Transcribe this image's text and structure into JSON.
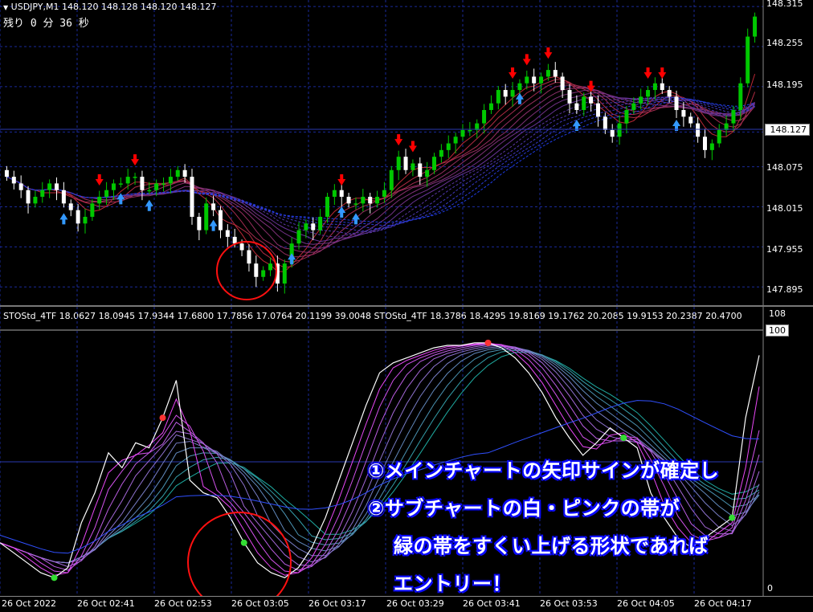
{
  "main_header": {
    "symbol_line": "USDJPY,M1  148.120 148.128 148.120 148.127",
    "countdown": "残り 0 分 36 秒"
  },
  "price_axis": {
    "ticks": [
      "148.315",
      "148.255",
      "148.195",
      "148.127",
      "148.075",
      "148.015",
      "147.955",
      "147.895"
    ],
    "current_price": "148.127"
  },
  "sub_header": {
    "text": "STOStd_4TF 18.0627 18.0945 17.9344 17.6800 17.7856 17.0764 20.1199 39.0048  STOStd_4TF 18.3786 18.4295 19.8169 19.1762 20.2085 19.9153 20.2387 20.4700"
  },
  "sub_axis": {
    "top_label": "108",
    "level_label": "100",
    "bottom_label": "0"
  },
  "time_axis": {
    "labels": [
      "26 Oct 2022",
      "26 Oct 02:41",
      "26 Oct 02:53",
      "26 Oct 03:05",
      "26 Oct 03:17",
      "26 Oct 03:29",
      "26 Oct 03:41",
      "26 Oct 03:53",
      "26 Oct 04:05",
      "26 Oct 04:17"
    ]
  },
  "annotations": {
    "line1": "①メインチャートの矢印サインが確定し",
    "line2": "②サブチャートの白・ピンクの帯が",
    "line3": "緑の帯をすくい上げる形状であれば",
    "line4": "エントリー！"
  },
  "colors": {
    "bull_candle": "#00c800",
    "bear_candle": "#ffffff",
    "up_arrow": "#3399ff",
    "down_arrow": "#ff0000",
    "grid": "#1a2a9a",
    "highlight_circle": "#ff0000",
    "stoch_white": "#ffffff",
    "stoch_pink": "#ff44ff",
    "stoch_green": "#20b0a0"
  },
  "chart_data": [
    {
      "type": "candlestick",
      "title": "USDJPY,M1",
      "ylim": [
        147.87,
        148.32
      ],
      "y_ticks": [
        147.895,
        147.955,
        148.015,
        148.075,
        148.127,
        148.195,
        148.255,
        148.315
      ],
      "close_approx": [
        148.06,
        148.05,
        148.04,
        148.02,
        148.03,
        148.04,
        148.05,
        148.04,
        148.02,
        148.01,
        147.99,
        148.0,
        148.02,
        148.03,
        148.04,
        148.05,
        148.05,
        148.06,
        148.06,
        148.04,
        148.04,
        148.05,
        148.05,
        148.06,
        148.07,
        148.06,
        148.0,
        147.98,
        148.02,
        148.01,
        147.98,
        147.97,
        147.96,
        147.95,
        147.93,
        147.91,
        147.92,
        147.93,
        147.9,
        147.93,
        147.96,
        147.98,
        147.99,
        147.98,
        148.0,
        148.03,
        148.04,
        148.03,
        148.02,
        148.02,
        148.03,
        148.02,
        148.03,
        148.04,
        148.07,
        148.09,
        148.07,
        148.08,
        148.06,
        148.07,
        148.09,
        148.1,
        148.11,
        148.12,
        148.13,
        148.13,
        148.14,
        148.16,
        148.17,
        148.19,
        148.18,
        148.19,
        148.2,
        148.21,
        148.2,
        148.21,
        148.22,
        148.21,
        148.19,
        148.17,
        148.16,
        148.18,
        148.17,
        148.15,
        148.13,
        148.12,
        148.14,
        148.16,
        148.17,
        148.18,
        148.19,
        148.2,
        148.19,
        148.18,
        148.16,
        148.15,
        148.14,
        148.12,
        148.1,
        148.11,
        148.13,
        148.14,
        148.16,
        148.2,
        148.27,
        148.3
      ]
    },
    {
      "type": "line",
      "title": "STOStd_4TF",
      "ylim": [
        0,
        108
      ],
      "level": 100,
      "series": [
        {
          "name": "",
          "color": "white"
        },
        {
          "name": "",
          "color": "pink"
        },
        {
          "name": "",
          "color": "green"
        }
      ]
    }
  ]
}
